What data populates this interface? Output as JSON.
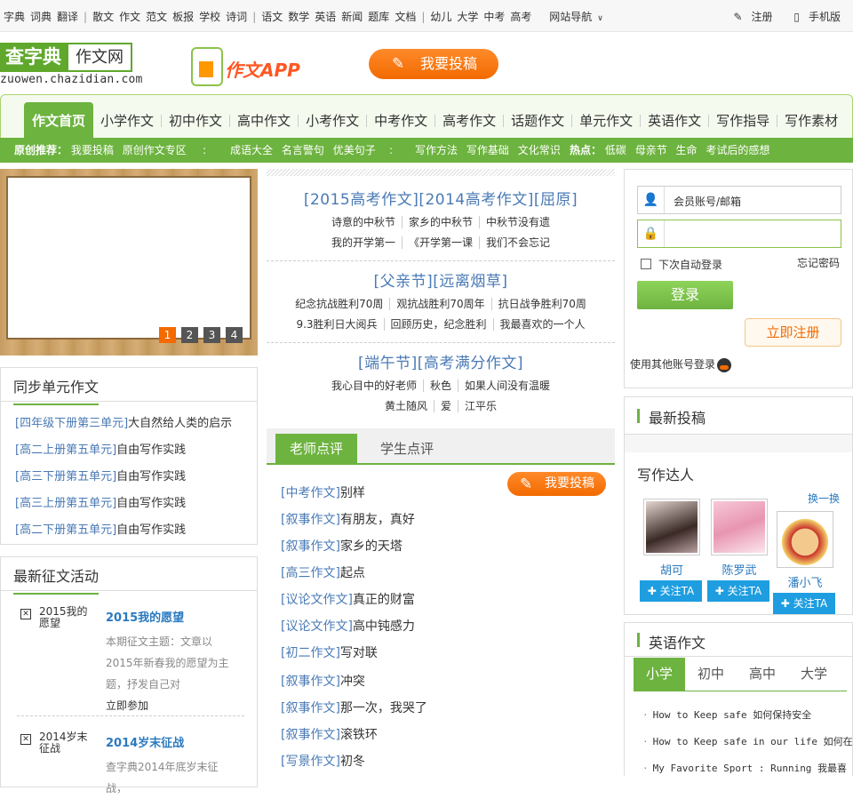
{
  "topbar": {
    "links": [
      "字典",
      "词典",
      "翻译",
      "散文",
      "作文",
      "范文",
      "板报",
      "学校",
      "诗词",
      "语文",
      "数学",
      "英语",
      "新闻",
      "题库",
      "文档",
      "幼儿",
      "大学",
      "中考",
      "高考"
    ],
    "sitenav": "网站导航",
    "register": "注册",
    "mobile": "手机版"
  },
  "logo": {
    "part1": "查字典",
    "part2": "作文网",
    "url": "zuowen.chazidian.com"
  },
  "app_promo": "作文APP",
  "submit_button": "我要投稿",
  "nav": {
    "tabs": [
      "作文首页",
      "小学作文",
      "初中作文",
      "高中作文",
      "小考作文",
      "中考作文",
      "高考作文",
      "话题作文",
      "单元作文",
      "英语作文",
      "写作指导",
      "写作素材"
    ]
  },
  "subnav": {
    "label1": "原创推荐：",
    "items1": [
      "我要投稿",
      "原创作文专区"
    ],
    "items2": [
      "成语大全",
      "名言警句",
      "优美句子"
    ],
    "items3": [
      "写作方法",
      "写作基础",
      "文化常识"
    ],
    "label2": "热点：",
    "items4": [
      "低碳",
      "母亲节",
      "生命",
      "考试后的感想"
    ]
  },
  "slider": {
    "pages": [
      "1",
      "2",
      "3",
      "4"
    ],
    "active": 0
  },
  "sync": {
    "title": "同步单元作文",
    "rows": [
      {
        "tag": "[四年级下册第三单元]",
        "title": "大自然给人类的启示"
      },
      {
        "tag": "[高二上册第五单元]",
        "title": "自由写作实践"
      },
      {
        "tag": "[高三下册第五单元]",
        "title": "自由写作实践"
      },
      {
        "tag": "[高三上册第五单元]",
        "title": "自由写作实践"
      },
      {
        "tag": "[高二下册第五单元]",
        "title": "自由写作实践"
      }
    ]
  },
  "contest": {
    "title": "最新征文活动",
    "items": [
      {
        "name": "2015我的愿望",
        "title": "2015我的愿望",
        "desc": "本期征文主题：文章以2015年新春我的愿望为主题，抒发自己对",
        "join": "立即参加"
      },
      {
        "name": "2014岁末征战",
        "title": "2014岁末征战",
        "desc": "查字典2014年底岁末征战，",
        "join": ""
      }
    ]
  },
  "middle": {
    "sections": [
      {
        "head": "[2015高考作文][2014高考作文][屈原]",
        "lines": [
          [
            "诗意的中秋节",
            "家乡的中秋节",
            "中秋节没有遗"
          ],
          [
            "我的开学第一",
            "《开学第一课",
            "我们不会忘记"
          ]
        ]
      },
      {
        "head": "[父亲节][远离烟草]",
        "lines": [
          [
            "纪念抗战胜利70周",
            "观抗战胜利70周年",
            "抗日战争胜利70周"
          ],
          [
            "9.3胜利日大阅兵",
            "回顾历史，纪念胜利",
            "我最喜欢的一个人"
          ]
        ]
      },
      {
        "head": "[端午节][高考满分作文]",
        "lines": [
          [
            "我心目中的好老师",
            "秋色",
            "如果人间没有温暖"
          ],
          [
            "黄土随风",
            "爱",
            "江平乐"
          ]
        ]
      }
    ],
    "tabs": [
      "老师点评",
      "学生点评"
    ],
    "articles": [
      {
        "tag": "[中考作文]",
        "title": "别样"
      },
      {
        "tag": "[叙事作文]",
        "title": "有朋友，真好"
      },
      {
        "tag": "[叙事作文]",
        "title": "家乡的天塔"
      },
      {
        "tag": "[高三作文]",
        "title": "起点"
      },
      {
        "tag": "[议论文作文]",
        "title": "真正的财富"
      },
      {
        "tag": "[议论文作文]",
        "title": "高中钝感力"
      },
      {
        "tag": "[初二作文]",
        "title": "写对联"
      },
      {
        "tag": "[叙事作文]",
        "title": "冲突"
      },
      {
        "tag": "[叙事作文]",
        "title": "那一次，我哭了"
      },
      {
        "tag": "[叙事作文]",
        "title": "滚铁环"
      },
      {
        "tag": "[写景作文]",
        "title": "初冬"
      }
    ]
  },
  "login": {
    "account_placeholder": "会员账号/邮箱",
    "auto_login": "下次自动登录",
    "forgot": "忘记密码",
    "login_btn": "登录",
    "register_btn": "立即注册",
    "other": "使用其他账号登录"
  },
  "newpost": {
    "title": "最新投稿",
    "writers_title": "写作达人",
    "switch": "换一换",
    "users": [
      {
        "name": "胡可",
        "follow": "关注TA"
      },
      {
        "name": "陈罗武",
        "follow": "关注TA"
      },
      {
        "name": "潘小飞",
        "follow": "关注TA"
      }
    ]
  },
  "english": {
    "title": "英语作文",
    "tabs": [
      "小学",
      "初中",
      "高中",
      "大学"
    ],
    "items": [
      "How to Keep safe 如何保持安全",
      "How to Keep safe in our life 如何在",
      "My Favorite Sport : Running 我最喜"
    ]
  },
  "colors": {
    "brand_green": "#6db33f",
    "accent_orange": "#f26a00",
    "link_blue": "#4a7ab5"
  }
}
